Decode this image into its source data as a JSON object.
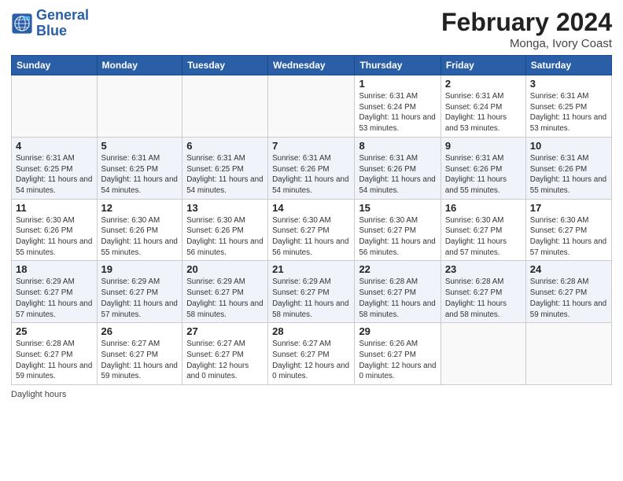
{
  "header": {
    "logo_line1": "General",
    "logo_line2": "Blue",
    "month_title": "February 2024",
    "location": "Monga, Ivory Coast"
  },
  "days_of_week": [
    "Sunday",
    "Monday",
    "Tuesday",
    "Wednesday",
    "Thursday",
    "Friday",
    "Saturday"
  ],
  "weeks": [
    [
      {
        "day": "",
        "info": ""
      },
      {
        "day": "",
        "info": ""
      },
      {
        "day": "",
        "info": ""
      },
      {
        "day": "",
        "info": ""
      },
      {
        "day": "1",
        "sunrise": "Sunrise: 6:31 AM",
        "sunset": "Sunset: 6:24 PM",
        "daylight": "Daylight: 11 hours and 53 minutes."
      },
      {
        "day": "2",
        "sunrise": "Sunrise: 6:31 AM",
        "sunset": "Sunset: 6:24 PM",
        "daylight": "Daylight: 11 hours and 53 minutes."
      },
      {
        "day": "3",
        "sunrise": "Sunrise: 6:31 AM",
        "sunset": "Sunset: 6:25 PM",
        "daylight": "Daylight: 11 hours and 53 minutes."
      }
    ],
    [
      {
        "day": "4",
        "sunrise": "Sunrise: 6:31 AM",
        "sunset": "Sunset: 6:25 PM",
        "daylight": "Daylight: 11 hours and 54 minutes."
      },
      {
        "day": "5",
        "sunrise": "Sunrise: 6:31 AM",
        "sunset": "Sunset: 6:25 PM",
        "daylight": "Daylight: 11 hours and 54 minutes."
      },
      {
        "day": "6",
        "sunrise": "Sunrise: 6:31 AM",
        "sunset": "Sunset: 6:25 PM",
        "daylight": "Daylight: 11 hours and 54 minutes."
      },
      {
        "day": "7",
        "sunrise": "Sunrise: 6:31 AM",
        "sunset": "Sunset: 6:26 PM",
        "daylight": "Daylight: 11 hours and 54 minutes."
      },
      {
        "day": "8",
        "sunrise": "Sunrise: 6:31 AM",
        "sunset": "Sunset: 6:26 PM",
        "daylight": "Daylight: 11 hours and 54 minutes."
      },
      {
        "day": "9",
        "sunrise": "Sunrise: 6:31 AM",
        "sunset": "Sunset: 6:26 PM",
        "daylight": "Daylight: 11 hours and 55 minutes."
      },
      {
        "day": "10",
        "sunrise": "Sunrise: 6:31 AM",
        "sunset": "Sunset: 6:26 PM",
        "daylight": "Daylight: 11 hours and 55 minutes."
      }
    ],
    [
      {
        "day": "11",
        "sunrise": "Sunrise: 6:30 AM",
        "sunset": "Sunset: 6:26 PM",
        "daylight": "Daylight: 11 hours and 55 minutes."
      },
      {
        "day": "12",
        "sunrise": "Sunrise: 6:30 AM",
        "sunset": "Sunset: 6:26 PM",
        "daylight": "Daylight: 11 hours and 55 minutes."
      },
      {
        "day": "13",
        "sunrise": "Sunrise: 6:30 AM",
        "sunset": "Sunset: 6:26 PM",
        "daylight": "Daylight: 11 hours and 56 minutes."
      },
      {
        "day": "14",
        "sunrise": "Sunrise: 6:30 AM",
        "sunset": "Sunset: 6:27 PM",
        "daylight": "Daylight: 11 hours and 56 minutes."
      },
      {
        "day": "15",
        "sunrise": "Sunrise: 6:30 AM",
        "sunset": "Sunset: 6:27 PM",
        "daylight": "Daylight: 11 hours and 56 minutes."
      },
      {
        "day": "16",
        "sunrise": "Sunrise: 6:30 AM",
        "sunset": "Sunset: 6:27 PM",
        "daylight": "Daylight: 11 hours and 57 minutes."
      },
      {
        "day": "17",
        "sunrise": "Sunrise: 6:30 AM",
        "sunset": "Sunset: 6:27 PM",
        "daylight": "Daylight: 11 hours and 57 minutes."
      }
    ],
    [
      {
        "day": "18",
        "sunrise": "Sunrise: 6:29 AM",
        "sunset": "Sunset: 6:27 PM",
        "daylight": "Daylight: 11 hours and 57 minutes."
      },
      {
        "day": "19",
        "sunrise": "Sunrise: 6:29 AM",
        "sunset": "Sunset: 6:27 PM",
        "daylight": "Daylight: 11 hours and 57 minutes."
      },
      {
        "day": "20",
        "sunrise": "Sunrise: 6:29 AM",
        "sunset": "Sunset: 6:27 PM",
        "daylight": "Daylight: 11 hours and 58 minutes."
      },
      {
        "day": "21",
        "sunrise": "Sunrise: 6:29 AM",
        "sunset": "Sunset: 6:27 PM",
        "daylight": "Daylight: 11 hours and 58 minutes."
      },
      {
        "day": "22",
        "sunrise": "Sunrise: 6:28 AM",
        "sunset": "Sunset: 6:27 PM",
        "daylight": "Daylight: 11 hours and 58 minutes."
      },
      {
        "day": "23",
        "sunrise": "Sunrise: 6:28 AM",
        "sunset": "Sunset: 6:27 PM",
        "daylight": "Daylight: 11 hours and 58 minutes."
      },
      {
        "day": "24",
        "sunrise": "Sunrise: 6:28 AM",
        "sunset": "Sunset: 6:27 PM",
        "daylight": "Daylight: 11 hours and 59 minutes."
      }
    ],
    [
      {
        "day": "25",
        "sunrise": "Sunrise: 6:28 AM",
        "sunset": "Sunset: 6:27 PM",
        "daylight": "Daylight: 11 hours and 59 minutes."
      },
      {
        "day": "26",
        "sunrise": "Sunrise: 6:27 AM",
        "sunset": "Sunset: 6:27 PM",
        "daylight": "Daylight: 11 hours and 59 minutes."
      },
      {
        "day": "27",
        "sunrise": "Sunrise: 6:27 AM",
        "sunset": "Sunset: 6:27 PM",
        "daylight": "Daylight: 12 hours and 0 minutes."
      },
      {
        "day": "28",
        "sunrise": "Sunrise: 6:27 AM",
        "sunset": "Sunset: 6:27 PM",
        "daylight": "Daylight: 12 hours and 0 minutes."
      },
      {
        "day": "29",
        "sunrise": "Sunrise: 6:26 AM",
        "sunset": "Sunset: 6:27 PM",
        "daylight": "Daylight: 12 hours and 0 minutes."
      },
      {
        "day": "",
        "info": ""
      },
      {
        "day": "",
        "info": ""
      }
    ]
  ],
  "footer": {
    "daylight_label": "Daylight hours"
  }
}
